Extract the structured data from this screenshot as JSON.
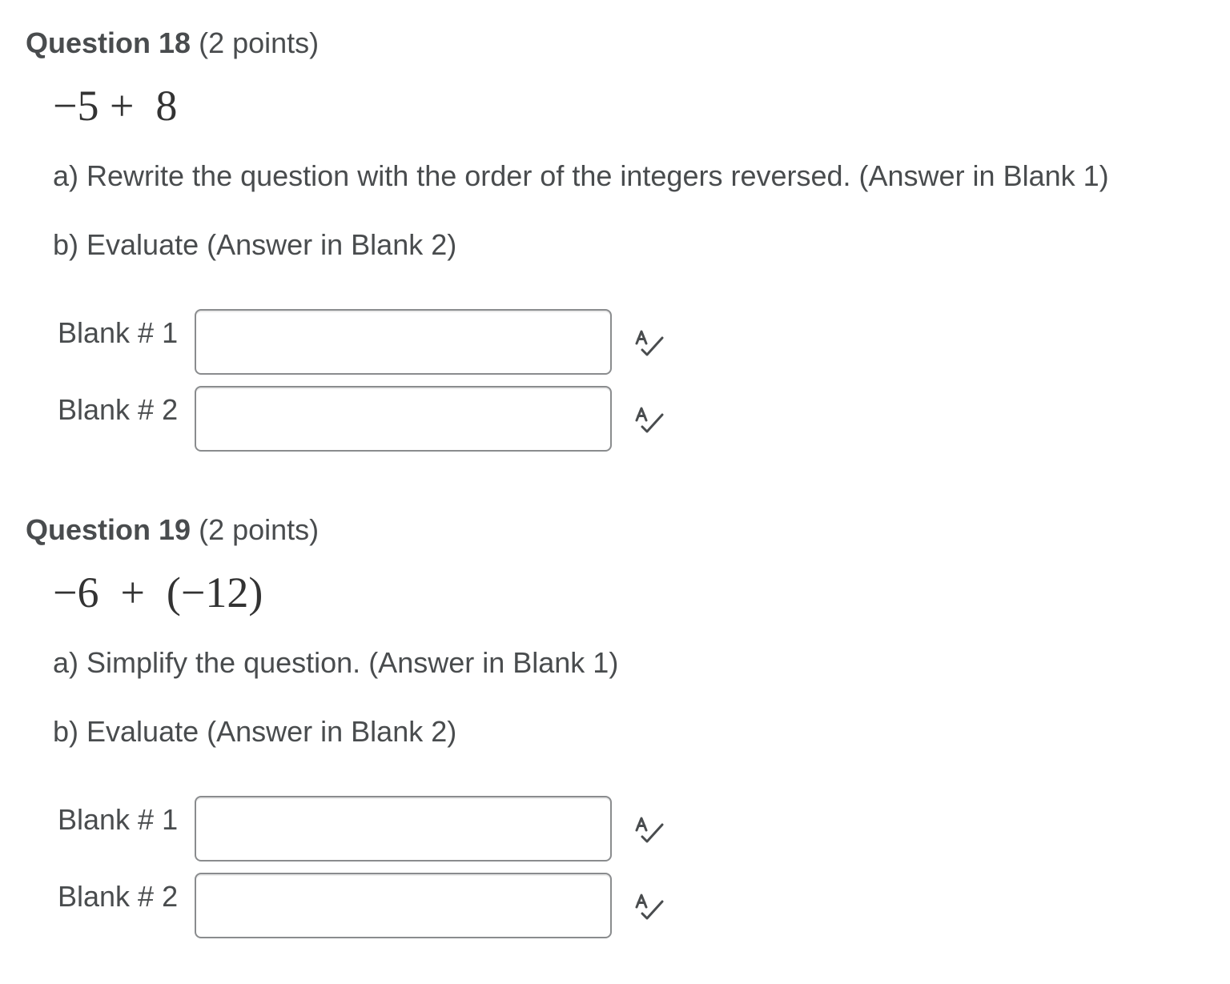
{
  "questions": [
    {
      "title": "Question 18",
      "points": "(2 points)",
      "expression": "−5 +  8",
      "part_a": "a) Rewrite the question with the order of the integers reversed. (Answer in Blank 1)",
      "part_b": "b) Evaluate (Answer in Blank 2)",
      "blanks": [
        {
          "label": "Blank # 1",
          "value": ""
        },
        {
          "label": "Blank # 2",
          "value": ""
        }
      ]
    },
    {
      "title": "Question 19",
      "points": "(2 points)",
      "expression": "−6  +  (−12)",
      "part_a": "a) Simplify the question. (Answer in Blank 1)",
      "part_b": "b) Evaluate (Answer in Blank 2)",
      "blanks": [
        {
          "label": "Blank # 1",
          "value": ""
        },
        {
          "label": "Blank # 2",
          "value": ""
        }
      ]
    }
  ],
  "icons": {
    "spell_check": "spellcheck-icon"
  },
  "colors": {
    "text": "#494c4e",
    "input_border": "#8a8c8e",
    "icon": "#494c4e"
  }
}
